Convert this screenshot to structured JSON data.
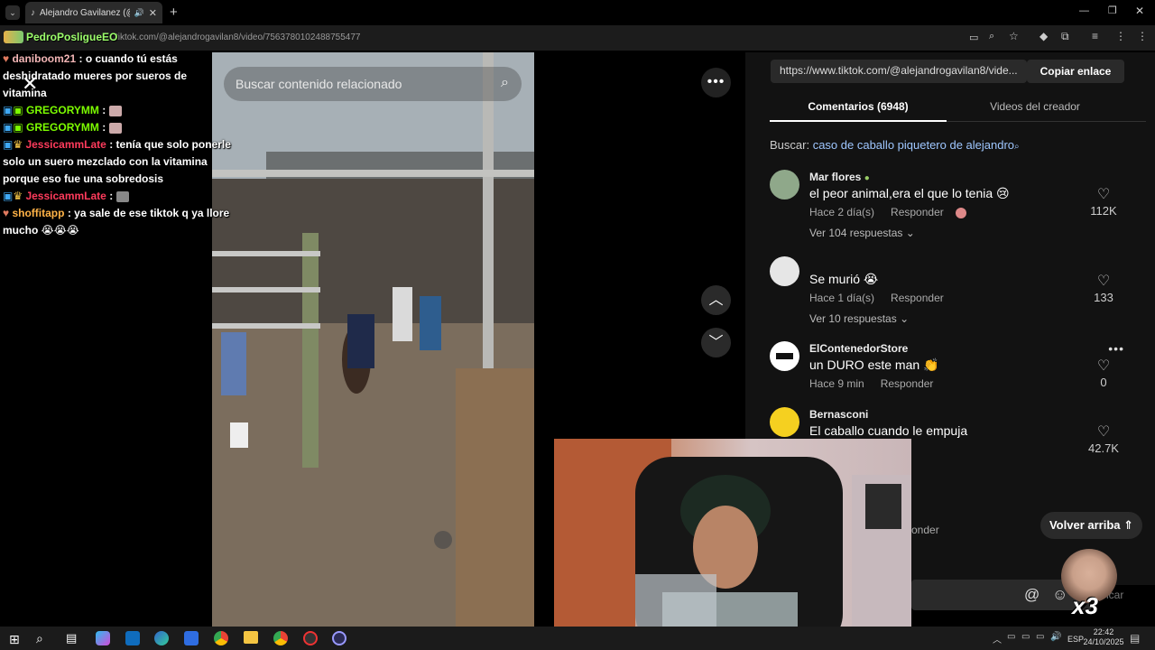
{
  "browser": {
    "tab_title": "Alejandro Gavilanez (@alej",
    "url": "tiktok.com/@alejandrogavilan8/video/7563780102488755477"
  },
  "overlay": {
    "streamer_name": "PedroPosligueEO",
    "x3_badge": "x3"
  },
  "chat": [
    {
      "user": "daniboom21",
      "text": ": o cuando tú estás deshidratado mueres por sueros de vitamina",
      "color": "#f2b5b5"
    },
    {
      "user": "GREGORYMM",
      "text": ":",
      "color": "#7CFC00"
    },
    {
      "user": "GREGORYMM",
      "text": ":",
      "color": "#7CFC00"
    },
    {
      "user": "JessicammLate",
      "text": ": tenía que solo ponerle solo un suero mezclado con la vitamina porque eso fue una sobredosis",
      "color": "#ff3b5c"
    },
    {
      "user": "JessicammLate",
      "text": ":",
      "color": "#ff3b5c"
    },
    {
      "user": "shoffitapp",
      "text": ": ya sale de ese tiktok q ya llore mucho 😭😭😭",
      "color": "#ffb347"
    }
  ],
  "video": {
    "search_placeholder": "Buscar contenido relacionado"
  },
  "panel": {
    "link": "https://www.tiktok.com/@alejandrogavilan8/vide...",
    "copy_label": "Copiar enlace",
    "tab_comments": "Comentarios (6948)",
    "tab_videos": "Videos del creador",
    "search_prefix": "Buscar:",
    "search_query": "caso de caballo piquetero de alejandro",
    "back_to_top": "Volver arriba"
  },
  "comments": [
    {
      "user": "Mar flores",
      "text": "el peor animal,era el que lo tenia 😢",
      "time": "Hace 2 día(s)",
      "reply": "Responder",
      "replies": "Ver 104 respuestas",
      "likes": "112K"
    },
    {
      "user": "",
      "text": "Se murió 😭",
      "time": "Hace 1 día(s)",
      "reply": "Responder",
      "replies": "Ver 10 respuestas",
      "likes": "133"
    },
    {
      "user": "ElContenedorStore",
      "text": "un DURO este man 👏",
      "time": "Hace 9 min",
      "reply": "Responder",
      "replies": "",
      "likes": "0"
    },
    {
      "user": "Bernasconi",
      "text": "El caballo cuando le empuja",
      "time": "",
      "reply": "",
      "replies": "",
      "likes": "42.7K"
    }
  ],
  "partial_text": {
    "responder_fragment": "onder",
    "publicar_fragment": "icar"
  },
  "taskbar": {
    "lang": "ESP",
    "time": "22:42",
    "date": "24/10/2025"
  }
}
